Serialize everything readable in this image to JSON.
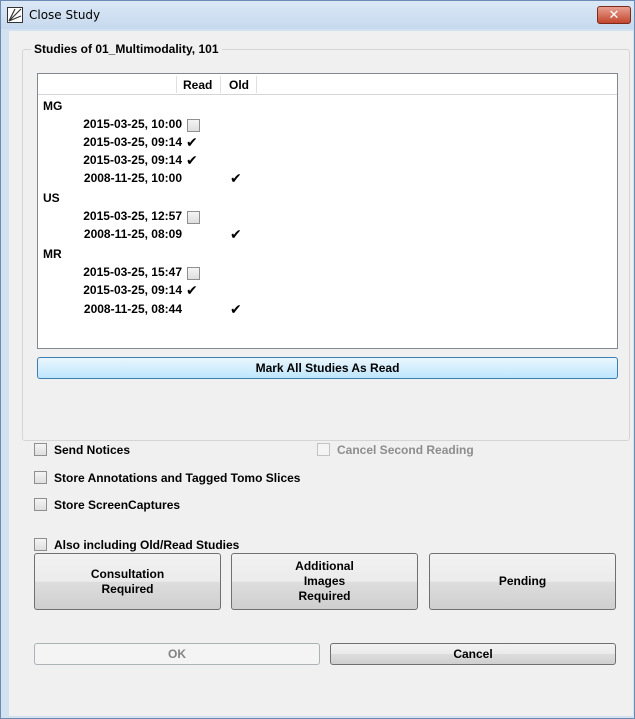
{
  "window": {
    "title": "Close Study",
    "close_symbol": "✕",
    "title_icon": "app-logo-icon"
  },
  "studies": {
    "group_title": "Studies of 01_Multimodality, 101",
    "columns": [
      "Read",
      "Old"
    ],
    "rows": [
      {
        "type": "group",
        "label": "MG"
      },
      {
        "type": "study",
        "date": "2015-03-25, 10:00",
        "read": "checkbox",
        "old": false
      },
      {
        "type": "study",
        "date": "2015-03-25, 09:14",
        "read": "✔",
        "old": false
      },
      {
        "type": "study",
        "date": "2015-03-25, 09:14",
        "read": "✔",
        "old": false
      },
      {
        "type": "study",
        "date": "2008-11-25, 10:00",
        "read": "",
        "old": "✔"
      },
      {
        "type": "group",
        "label": "US"
      },
      {
        "type": "study",
        "date": "2015-03-25, 12:57",
        "read": "checkbox",
        "old": false
      },
      {
        "type": "study",
        "date": "2008-11-25, 08:09",
        "read": "",
        "old": "✔"
      },
      {
        "type": "group",
        "label": "MR"
      },
      {
        "type": "study",
        "date": "2015-03-25, 15:47",
        "read": "checkbox",
        "old": false
      },
      {
        "type": "study",
        "date": "2015-03-25, 09:14",
        "read": "✔",
        "old": false
      },
      {
        "type": "study",
        "date": "2008-11-25, 08:44",
        "read": "",
        "old": "✔"
      }
    ],
    "mark_all_label": "Mark All Studies As Read"
  },
  "options": {
    "send_notices": {
      "label": "Send Notices",
      "checked": false,
      "enabled": true
    },
    "cancel_second_reading": {
      "label": "Cancel Second Reading",
      "checked": false,
      "enabled": false
    },
    "store_annotations": {
      "label": "Store Annotations and Tagged Tomo Slices",
      "checked": false,
      "enabled": true
    },
    "store_screencaptures": {
      "label": "Store ScreenCaptures",
      "checked": false,
      "enabled": true
    },
    "include_old_read": {
      "label": "Also including Old/Read Studies",
      "checked": false,
      "enabled": true
    }
  },
  "actions": {
    "consultation": "Consultation\nRequired",
    "additional_images": "Additional\nImages\nRequired",
    "pending": "Pending"
  },
  "footer": {
    "ok": "OK",
    "cancel": "Cancel"
  },
  "colors": {
    "title_bar": "#c6d9ee",
    "close_button": "#c3462c",
    "mark_all_button": "#bee6fd",
    "mark_all_border": "#3c7fb1",
    "dialog_background": "#f0f0f0"
  }
}
